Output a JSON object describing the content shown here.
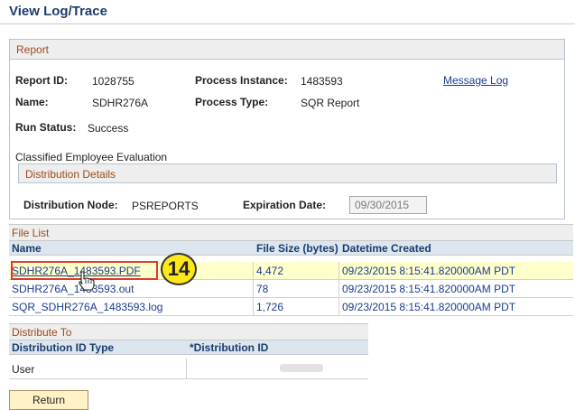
{
  "page": {
    "title": "View Log/Trace"
  },
  "report": {
    "section_title": "Report",
    "report_id_label": "Report ID:",
    "report_id": "1028755",
    "process_instance_label": "Process Instance:",
    "process_instance": "1483593",
    "message_log_link": "Message Log",
    "name_label": "Name:",
    "name": "SDHR276A",
    "process_type_label": "Process Type:",
    "process_type": "SQR Report",
    "run_status_label": "Run Status:",
    "run_status": "Success",
    "description": "Classified Employee Evaluation"
  },
  "distribution": {
    "section_title": "Distribution Details",
    "node_label": "Distribution Node:",
    "node": "PSREPORTS",
    "expiration_label": "Expiration Date:",
    "expiration_date": "09/30/2015"
  },
  "file_list": {
    "title": "File List",
    "columns": [
      "Name",
      "File Size (bytes)",
      "Datetime Created"
    ],
    "rows": [
      {
        "name": "SDHR276A_1483593.PDF",
        "size": "4,472",
        "created": "09/23/2015  8:15:41.820000AM PDT"
      },
      {
        "name": "SDHR276A_1483593.out",
        "size": "78",
        "created": "09/23/2015  8:15:41.820000AM PDT"
      },
      {
        "name": "SQR_SDHR276A_1483593.log",
        "size": "1,726",
        "created": "09/23/2015  8:15:41.820000AM PDT"
      }
    ]
  },
  "callout": {
    "step_number": "14"
  },
  "distribute_to": {
    "title": "Distribute To",
    "columns": [
      "Distribution ID Type",
      "*Distribution ID"
    ],
    "rows": [
      {
        "type": "User",
        "id": ""
      }
    ]
  },
  "buttons": {
    "return_label": "Return"
  },
  "colors": {
    "title_blue": "#1f3c6f",
    "section_header_text": "#9c4a1c",
    "link_blue": "#1a3c8f",
    "highlight_row": "#ffffcc",
    "callout_red": "#e03a2a",
    "badge_yellow": "#ffe81a"
  },
  "icons": {
    "cursor": "hand-pointer-icon"
  }
}
